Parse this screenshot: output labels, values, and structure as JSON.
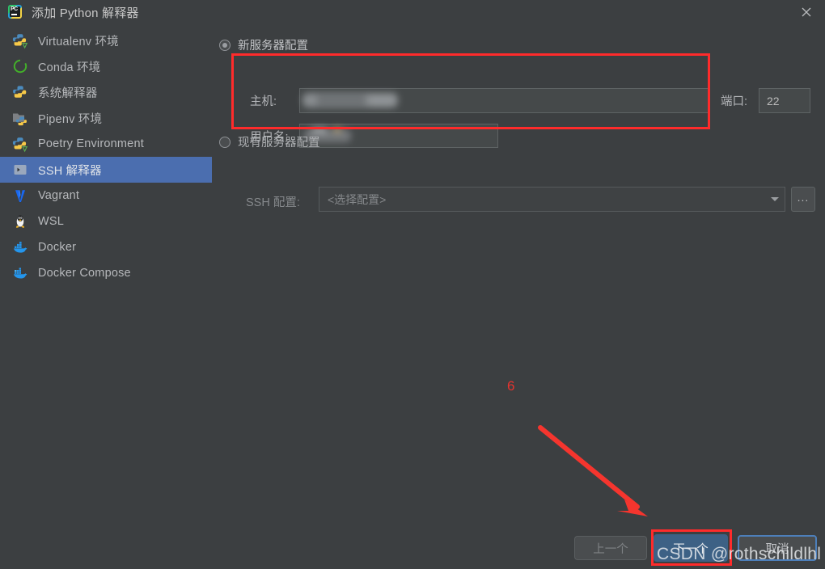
{
  "window": {
    "title": "添加 Python 解释器",
    "app_icon": "pycharm-icon",
    "icon_text": "PC",
    "close_icon": "close-icon"
  },
  "sidebar": {
    "items": [
      {
        "label": "Virtualenv 环境",
        "icon": "python-venv-icon",
        "selected": false
      },
      {
        "label": "Conda 环境",
        "icon": "conda-icon",
        "selected": false
      },
      {
        "label": "系统解释器",
        "icon": "python-icon",
        "selected": false
      },
      {
        "label": "Pipenv 环境",
        "icon": "pipenv-icon",
        "selected": false
      },
      {
        "label": "Poetry Environment",
        "icon": "poetry-icon",
        "selected": false
      },
      {
        "label": "SSH 解释器",
        "icon": "ssh-terminal-icon",
        "selected": true
      },
      {
        "label": "Vagrant",
        "icon": "vagrant-icon",
        "selected": false
      },
      {
        "label": "WSL",
        "icon": "linux-penguin-icon",
        "selected": false
      },
      {
        "label": "Docker",
        "icon": "docker-icon",
        "selected": false
      },
      {
        "label": "Docker Compose",
        "icon": "docker-compose-icon",
        "selected": false
      }
    ]
  },
  "main": {
    "new_server": {
      "radio_label": "新服务器配置",
      "selected": true,
      "host_label": "主机:",
      "host_value": "",
      "port_label": "端口:",
      "port_value": "22",
      "username_label": "用户名:",
      "username_value": ""
    },
    "existing_server": {
      "radio_label": "现有服务器配置",
      "selected": false,
      "ssh_config_label": "SSH 配置:",
      "ssh_config_placeholder": "<选择配置>",
      "browse_label": "...",
      "dropdown_icon": "chevron-down-icon"
    }
  },
  "footer": {
    "back_label": "上一个",
    "next_label": "下一个",
    "cancel_label": "取消"
  },
  "annotations": {
    "step_number": "6",
    "watermark": "CSDN @rothschildlhl",
    "highlight_color": "#ff2b2b",
    "arrow_icon": "red-arrow-icon"
  },
  "colors": {
    "background": "#3c3f41",
    "selection": "#4b6eaf",
    "primary_button": "#3d6185",
    "annotation_red": "#ff2b2b",
    "focus_ring": "#4d7fba"
  }
}
